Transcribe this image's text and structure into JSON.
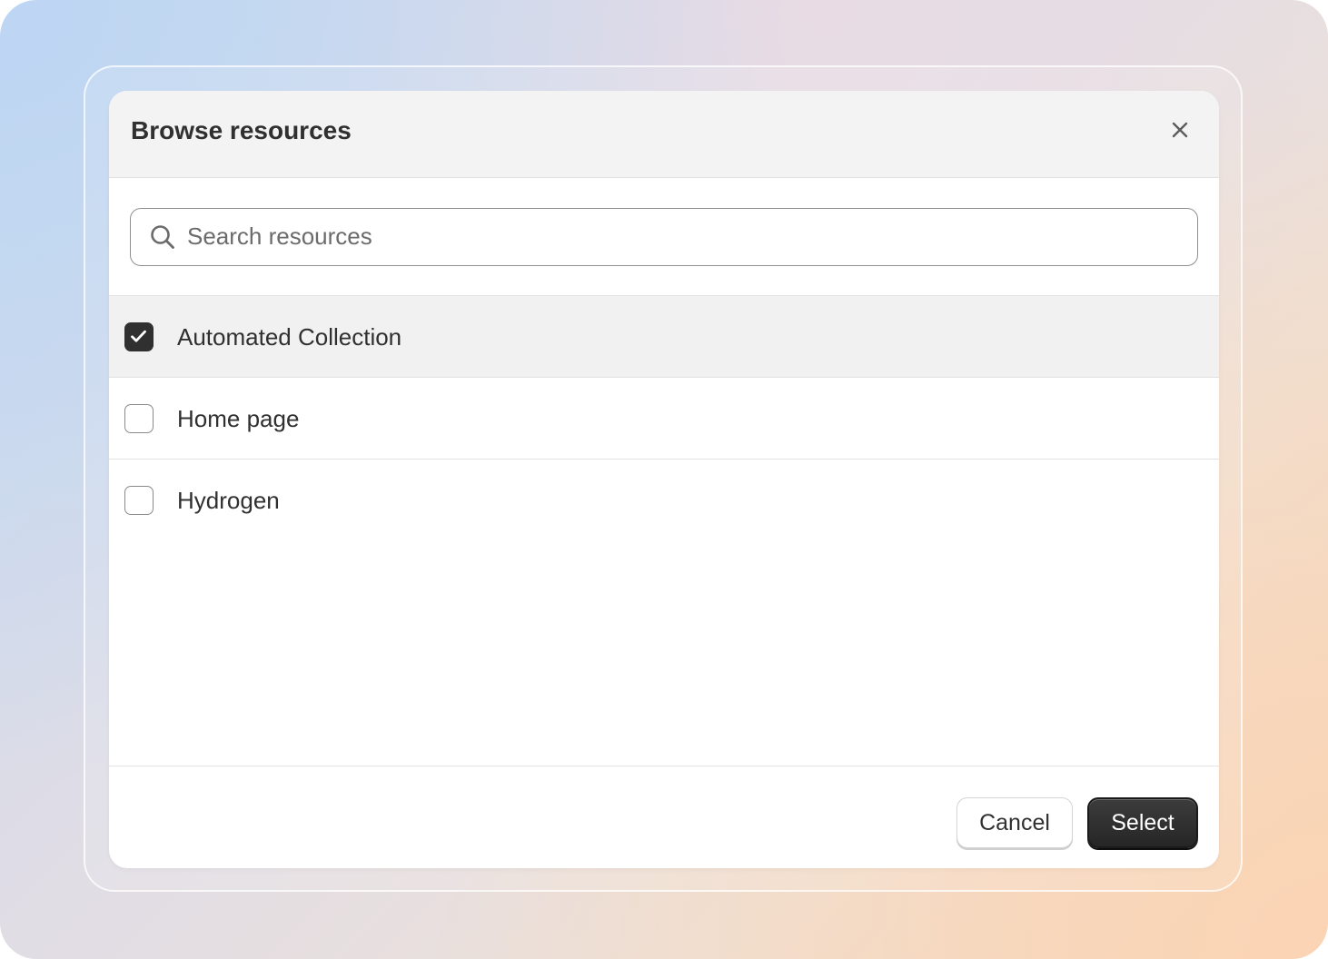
{
  "modal": {
    "title": "Browse resources"
  },
  "search": {
    "placeholder": "Search resources",
    "value": ""
  },
  "resources": [
    {
      "label": "Automated Collection",
      "checked": true
    },
    {
      "label": "Home page",
      "checked": false
    },
    {
      "label": "Hydrogen",
      "checked": false
    }
  ],
  "footer": {
    "cancel_label": "Cancel",
    "select_label": "Select"
  },
  "icons": {
    "close": "close-icon",
    "search": "search-icon",
    "check": "checkmark-icon"
  },
  "colors": {
    "primary_button": "#303030",
    "header_background": "#f3f3f3",
    "selected_row": "#f1f1f1"
  }
}
